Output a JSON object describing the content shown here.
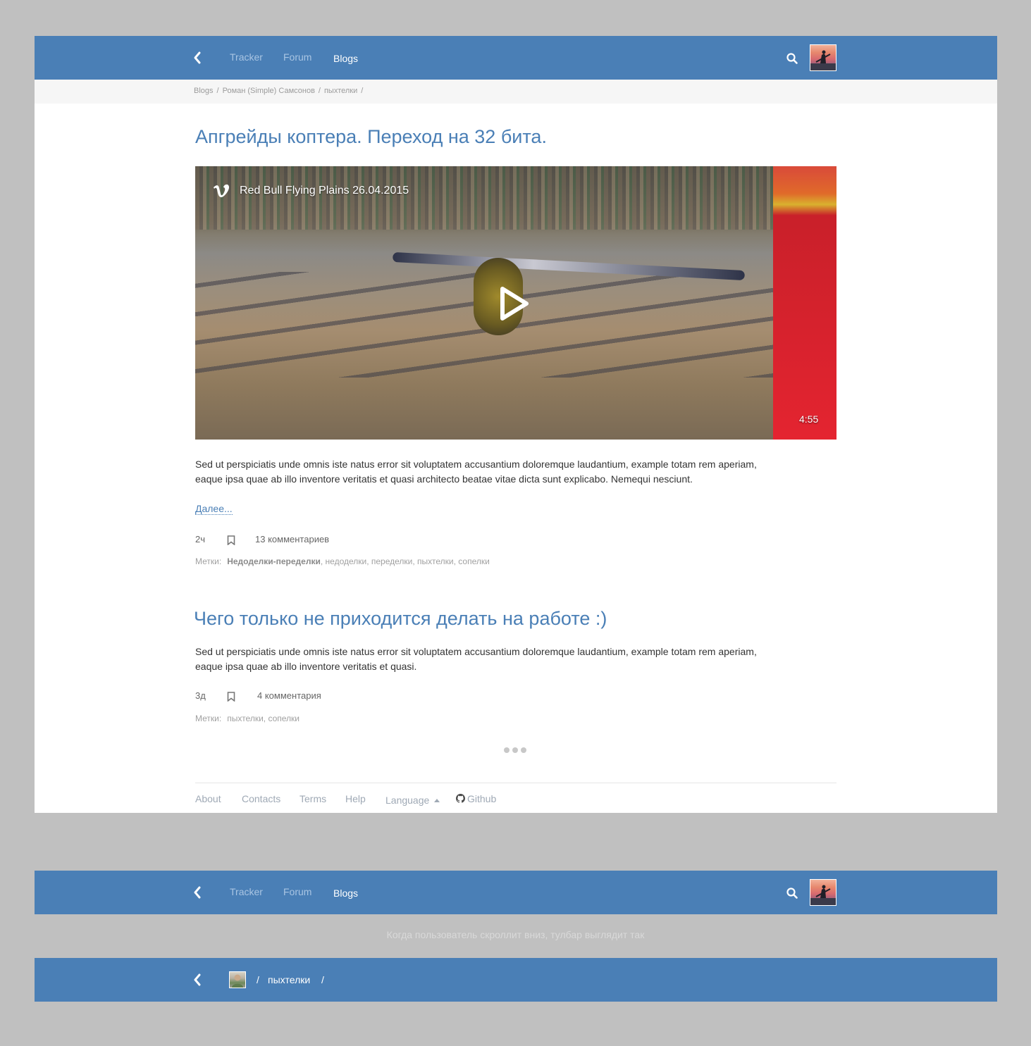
{
  "toolbar": {
    "nav": [
      {
        "label": "Tracker"
      },
      {
        "label": "Forum"
      },
      {
        "label": "Blogs"
      }
    ]
  },
  "breadcrumb": {
    "items": [
      "Blogs",
      "Роман (Simple) Самсонов",
      "пыхтелки"
    ],
    "separator": "/"
  },
  "posts": [
    {
      "title": "Апгрейды коптера. Переход на 32 бита.",
      "video": {
        "provider_icon": "vimeo-icon",
        "title": "Red Bull Flying Plains 26.04.2015",
        "duration": "4:55"
      },
      "text_line1": "Sed ut perspiciatis unde omnis iste natus error sit voluptatem accusantium doloremque laudantium, example totam rem aperiam,",
      "text_line2": "eaque ipsa quae ab illo inventore veritatis et quasi architecto beatae vitae dicta sunt explicabo. Nemequi nesciunt.",
      "read_more": "Далее...",
      "time": "2ч",
      "comments": "13 комментариев",
      "tags_label": "Метки:",
      "tags_bold": "Недоделки-переделки",
      "tags_rest": ", недоделки, переделки, пыхтелки, сопелки"
    },
    {
      "title": "Чего только не приходится делать на работе :)",
      "text_line1": "Sed ut perspiciatis unde omnis iste natus error sit voluptatem accusantium doloremque laudantium, example totam rem aperiam,",
      "text_line2": "eaque ipsa quae ab illo inventore veritatis et quasi.",
      "time": "3д",
      "comments": "4 комментария",
      "tags_label": "Метки:",
      "tags_rest": "пыхтелки, сопелки"
    }
  ],
  "footer": {
    "links": [
      "About",
      "Contacts",
      "Terms",
      "Help",
      "Language",
      "Github"
    ]
  },
  "caption": "Когда пользователь скроллит вниз, тулбар выглядит так",
  "scrolled_toolbar": {
    "crumb": "пыхтелки",
    "separator": "/"
  },
  "colors": {
    "toolbar_bg": "#4a7fb6",
    "title": "#4a7fb6",
    "page_bg": "#c0c0c0"
  }
}
